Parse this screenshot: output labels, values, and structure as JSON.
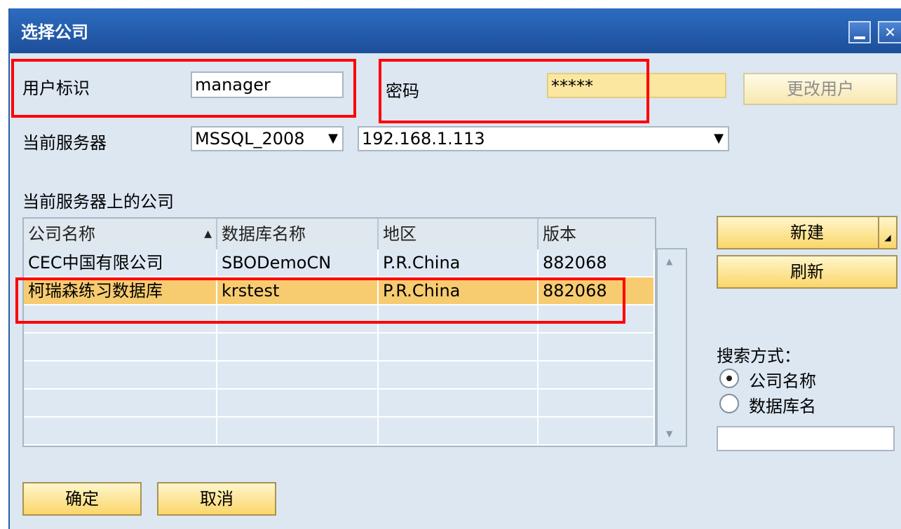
{
  "window": {
    "title": "选择公司"
  },
  "form": {
    "user_label": "用户标识",
    "user_value": "manager",
    "password_label": "密码",
    "password_value": "*****",
    "change_user_button": "更改用户",
    "server_label": "当前服务器",
    "server_type_value": "MSSQL_2008",
    "server_ip_value": "192.168.1.113"
  },
  "companies": {
    "section_label": "当前服务器上的公司",
    "columns": [
      "公司名称",
      "数据库名称",
      "地区",
      "版本"
    ],
    "rows": [
      [
        "CEC中国有限公司",
        "SBODemoCN",
        "P.R.China",
        "882068"
      ],
      [
        "柯瑞森练习数据库",
        "krstest",
        "P.R.China",
        "882068"
      ]
    ]
  },
  "side": {
    "new_button": "新建",
    "refresh_button": "刷新",
    "search_label": "搜索方式：",
    "radio_company": "公司名称",
    "radio_db": "数据库名",
    "selected_search": "公司名称"
  },
  "actions": {
    "ok_button": "确定",
    "cancel_button": "取消"
  },
  "colors": {
    "accent_red": "#ff0000",
    "selection": "#f7cc70",
    "title_bar": "#1d4f9a"
  }
}
